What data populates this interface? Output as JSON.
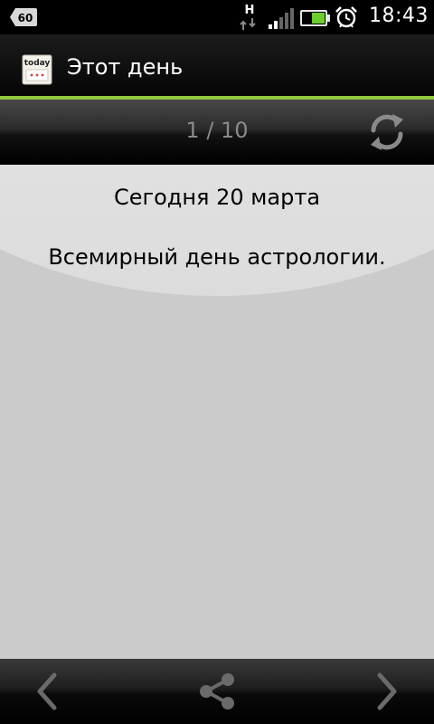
{
  "status_bar": {
    "badge": "60",
    "network_type": "H",
    "time": "18:43",
    "icons": [
      "notification-badge-icon",
      "network-h-icon",
      "signal-icon",
      "battery-icon",
      "alarm-icon"
    ],
    "battery_color": "#6ccd2e"
  },
  "app_bar": {
    "title": "Этот день",
    "icon_text": "today",
    "accent_color": "#8fc83a"
  },
  "toolbar": {
    "page_counter": "1 / 10",
    "refresh_icon": "refresh-icon"
  },
  "content": {
    "date": "Сегодня 20 марта",
    "event": "Всемирный день астрологии."
  },
  "bottom_bar": {
    "prev_icon": "chevron-left-icon",
    "share_icon": "share-icon",
    "next_icon": "chevron-right-icon"
  }
}
